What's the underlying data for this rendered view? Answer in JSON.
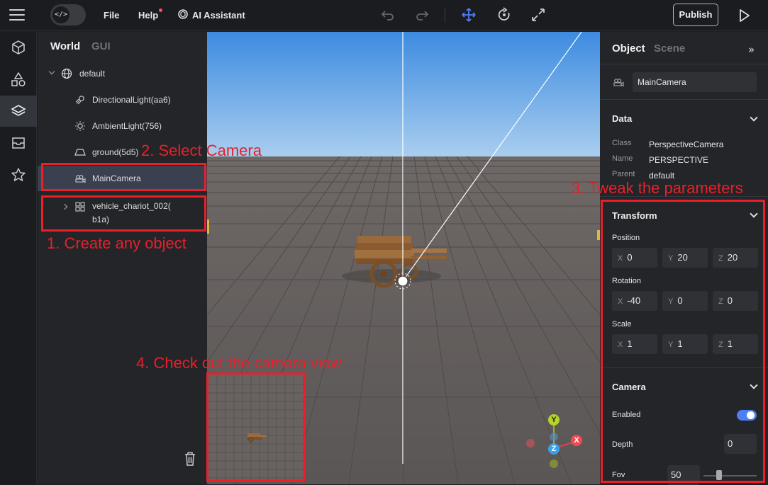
{
  "topbar": {
    "file_label": "File",
    "help_label": "Help",
    "ai_label": "AI Assistant",
    "publish_label": "Publish",
    "code_toggle_glyph": "</>"
  },
  "left_tabs": {
    "world": "World",
    "gui": "GUI"
  },
  "tree": {
    "root": "default",
    "items": [
      {
        "label": "DirectionalLight(aa6)",
        "icon": "directional-light-icon"
      },
      {
        "label": "AmbientLight(756)",
        "icon": "ambient-light-icon"
      },
      {
        "label": "ground(5d5)",
        "icon": "ground-icon"
      },
      {
        "label": "MainCamera",
        "icon": "camera-icon",
        "selected": true
      },
      {
        "label_line1": "vehicle_chariot_002(",
        "label_line2": "b1a)",
        "icon": "group-icon"
      }
    ]
  },
  "inspector": {
    "tabs": {
      "object": "Object",
      "scene": "Scene"
    },
    "object_name": "MainCamera",
    "data": {
      "title": "Data",
      "class_label": "Class",
      "class_value": "PerspectiveCamera",
      "name_label": "Name",
      "name_value": "PERSPECTIVE",
      "parent_label": "Parent",
      "parent_value": "default"
    },
    "transform": {
      "title": "Transform",
      "position_label": "Position",
      "position": {
        "x": "0",
        "y": "20",
        "z": "20"
      },
      "rotation_label": "Rotation",
      "rotation": {
        "x": "-40",
        "y": "0",
        "z": "0"
      },
      "scale_label": "Scale",
      "scale": {
        "x": "1",
        "y": "1",
        "z": "1"
      },
      "axis_x": "X",
      "axis_y": "Y",
      "axis_z": "Z"
    },
    "camera": {
      "title": "Camera",
      "enabled_label": "Enabled",
      "enabled": true,
      "depth_label": "Depth",
      "depth_value": "0",
      "fov_label": "Fov",
      "fov_value": "50"
    }
  },
  "gizmo": {
    "y": "Y",
    "z": "Z",
    "x": "X"
  },
  "annotations": {
    "step1": "1. Create any object",
    "step2": "2. Select Camera",
    "step3": "3. Tweak the parameters",
    "step4": "4. Check out the camera view"
  },
  "colors": {
    "accent": "#4f7df5",
    "annotation_red": "#e8202a",
    "selected_row": "#3b4050"
  }
}
